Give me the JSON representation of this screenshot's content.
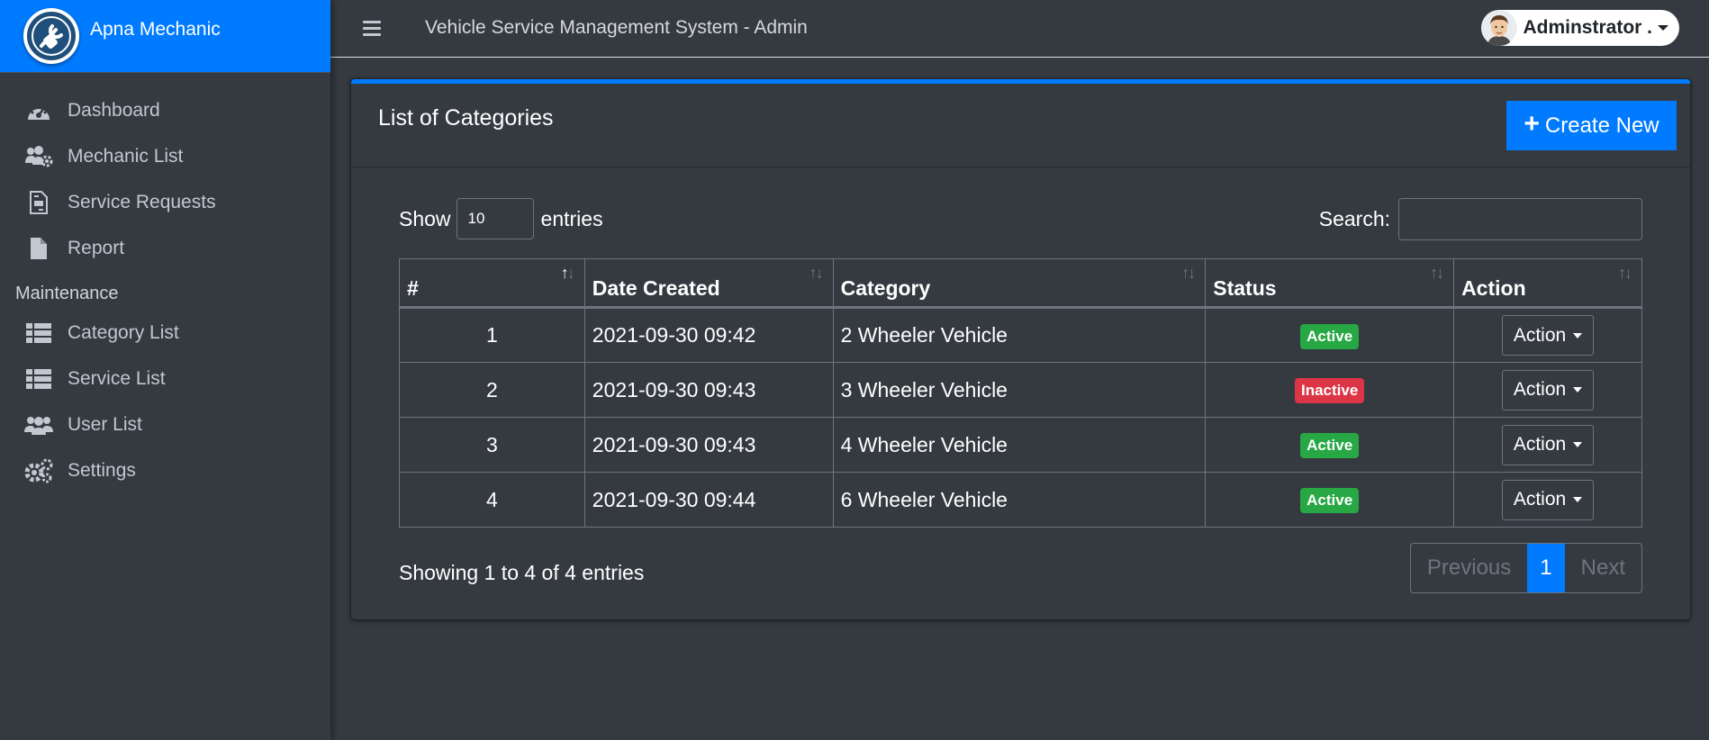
{
  "brand": {
    "name": "Apna Mechanic"
  },
  "sidebar": {
    "items": [
      {
        "label": "Dashboard",
        "icon": "tachometer-icon"
      },
      {
        "label": "Mechanic List",
        "icon": "users-cog-icon"
      },
      {
        "label": "Service Requests",
        "icon": "file-invoice-icon"
      },
      {
        "label": "Report",
        "icon": "file-icon"
      }
    ],
    "section_header": "Maintenance",
    "maintenance_items": [
      {
        "label": "Category List",
        "icon": "th-list-icon"
      },
      {
        "label": "Service List",
        "icon": "th-list-icon"
      },
      {
        "label": "User List",
        "icon": "users-icon"
      },
      {
        "label": "Settings",
        "icon": "cogs-icon"
      }
    ]
  },
  "header": {
    "title": "Vehicle Service Management System - Admin",
    "user_name": "Adminstrator ."
  },
  "card": {
    "title": "List of Categories",
    "create_label": "Create New"
  },
  "table_controls": {
    "show_label": "Show",
    "entries_value": "10",
    "entries_label": "entries",
    "search_label": "Search:"
  },
  "table": {
    "columns": [
      "#",
      "Date Created",
      "Category",
      "Status",
      "Action"
    ],
    "rows": [
      {
        "num": "1",
        "date": "2021-09-30 09:42",
        "category": "2 Wheeler Vehicle",
        "status": "Active",
        "action": "Action"
      },
      {
        "num": "2",
        "date": "2021-09-30 09:43",
        "category": "3 Wheeler Vehicle",
        "status": "Inactive",
        "action": "Action"
      },
      {
        "num": "3",
        "date": "2021-09-30 09:43",
        "category": "4 Wheeler Vehicle",
        "status": "Active",
        "action": "Action"
      },
      {
        "num": "4",
        "date": "2021-09-30 09:44",
        "category": "6 Wheeler Vehicle",
        "status": "Active",
        "action": "Action"
      }
    ]
  },
  "footer": {
    "info": "Showing 1 to 4 of 4 entries",
    "previous": "Previous",
    "current_page": "1",
    "next": "Next"
  },
  "colors": {
    "primary": "#007bff",
    "background": "#343a40",
    "success": "#28a745",
    "danger": "#dc3545"
  }
}
